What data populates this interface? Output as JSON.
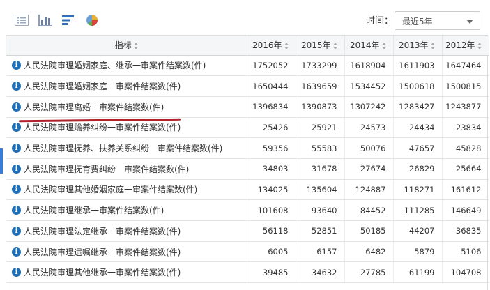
{
  "toolbar": {
    "icons": [
      "list-view-icon",
      "bar-chart-icon",
      "bar-list-icon",
      "pie-chart-icon"
    ],
    "time_label": "时间：",
    "time_select": "最近5年"
  },
  "table": {
    "header_indicator": "指标",
    "years": [
      "2016年",
      "2015年",
      "2014年",
      "2013年",
      "2012年"
    ],
    "rows": [
      {
        "label": "人民法院审理婚姻家庭、继承一审案件结案数(件)",
        "values": [
          "1752052",
          "1733299",
          "1618904",
          "1611903",
          "1647464"
        ]
      },
      {
        "label": "人民法院审理婚姻家庭一审案件结案数(件)",
        "values": [
          "1650444",
          "1639659",
          "1534452",
          "1500618",
          "1500815"
        ]
      },
      {
        "label": "人民法院审理离婚一审案件结案数(件)",
        "values": [
          "1396834",
          "1390873",
          "1307242",
          "1283427",
          "1243877"
        ]
      },
      {
        "label": "人民法院审理赡养纠纷一审案件结案数(件)",
        "values": [
          "25426",
          "25921",
          "24573",
          "24434",
          "23834"
        ]
      },
      {
        "label": "人民法院审理抚养、扶养关系纠纷一审案件结案数(件)",
        "values": [
          "59356",
          "55583",
          "50076",
          "47657",
          "45828"
        ]
      },
      {
        "label": "人民法院审理抚育费纠纷一审案件结案数(件)",
        "values": [
          "34803",
          "31678",
          "27674",
          "26829",
          "25664"
        ]
      },
      {
        "label": "人民法院审理其他婚姻家庭一审案件结案数(件)",
        "values": [
          "134025",
          "135604",
          "124887",
          "118271",
          "161612"
        ]
      },
      {
        "label": "人民法院审理继承一审案件结案数(件)",
        "values": [
          "101608",
          "93640",
          "84452",
          "111285",
          "146649"
        ]
      },
      {
        "label": "人民法院审理法定继承一审案件结案数(件)",
        "values": [
          "56118",
          "52851",
          "50185",
          "44207",
          "36835"
        ]
      },
      {
        "label": "人民法院审理遗嘱继承一审案件结案数(件)",
        "values": [
          "6005",
          "6157",
          "6482",
          "5879",
          "5106"
        ]
      },
      {
        "label": "人民法院审理其他继承一审案件结案数(件)",
        "values": [
          "39485",
          "34632",
          "27785",
          "61199",
          "104708"
        ]
      }
    ]
  },
  "colors": {
    "info_icon": "#1f6fb8",
    "highlight_underline": "#b0222a",
    "header_bg": "#f5f6f8"
  }
}
